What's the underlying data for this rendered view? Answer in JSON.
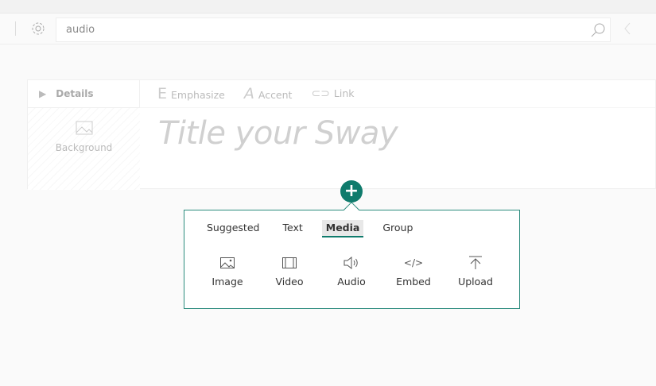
{
  "search": {
    "value": "audio"
  },
  "details": {
    "label": "Details",
    "background_label": "Background"
  },
  "format": {
    "emphasize": "Emphasize",
    "accent": "Accent",
    "link": "Link"
  },
  "title_placeholder": "Title your Sway",
  "insert": {
    "plus": "+",
    "tabs": [
      {
        "label": "Suggested"
      },
      {
        "label": "Text"
      },
      {
        "label": "Media",
        "active": true
      },
      {
        "label": "Group"
      }
    ],
    "items": [
      {
        "label": "Image",
        "icon": "image-icon"
      },
      {
        "label": "Video",
        "icon": "video-icon"
      },
      {
        "label": "Audio",
        "icon": "audio-icon"
      },
      {
        "label": "Embed",
        "icon": "embed-icon"
      },
      {
        "label": "Upload",
        "icon": "upload-icon"
      }
    ]
  },
  "colors": {
    "accent": "#0f7b6c"
  }
}
